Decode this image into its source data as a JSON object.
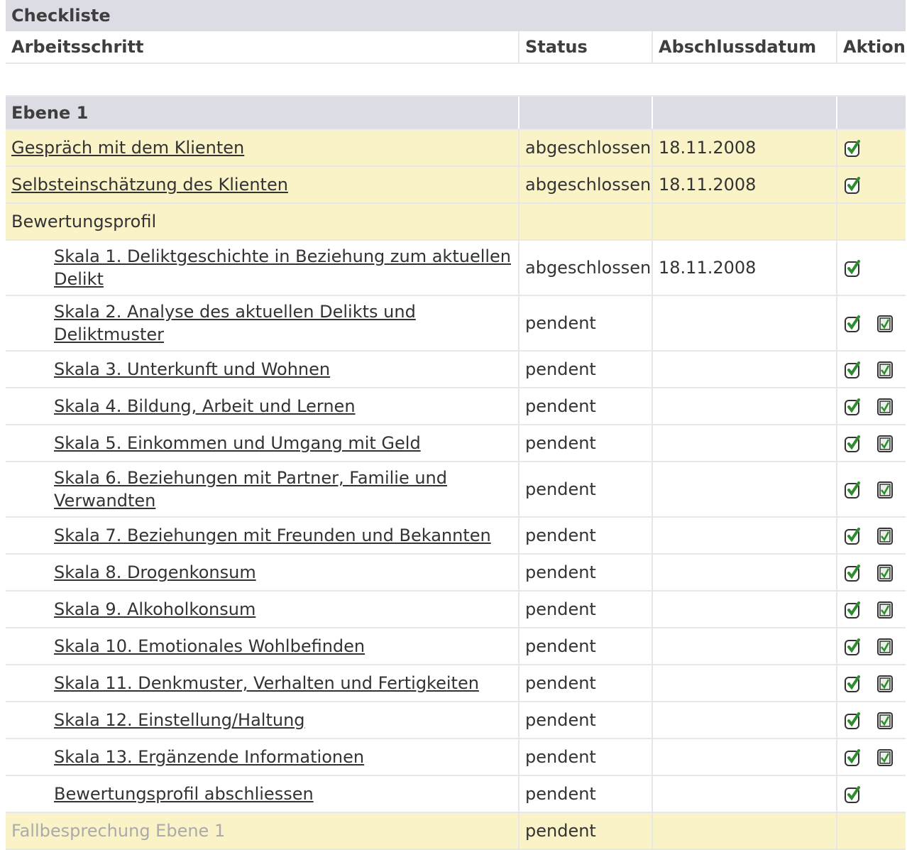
{
  "table": {
    "title": "Checkliste",
    "headers": {
      "step": "Arbeitsschritt",
      "status": "Status",
      "date": "Abschlussdatum",
      "action": "Aktion"
    },
    "level_label": "Ebene 1"
  },
  "rows": [
    {
      "label": "Gespräch mit dem Klienten",
      "status": "abgeschlossen",
      "date": "18.11.2008"
    },
    {
      "label": "Selbsteinschätzung des Klienten",
      "status": "abgeschlossen",
      "date": "18.11.2008"
    },
    {
      "label": "Bewertungsprofil",
      "status": "",
      "date": ""
    },
    {
      "label": "Skala 1. Deliktgeschichte in Beziehung zum aktuellen Delikt",
      "status": "abgeschlossen",
      "date": "18.11.2008"
    },
    {
      "label": "Skala 2. Analyse des aktuellen Delikts und Deliktmuster",
      "status": "pendent",
      "date": ""
    },
    {
      "label": "Skala 3. Unterkunft und Wohnen",
      "status": "pendent",
      "date": ""
    },
    {
      "label": "Skala 4. Bildung, Arbeit und Lernen",
      "status": "pendent",
      "date": ""
    },
    {
      "label": "Skala 5. Einkommen und Umgang mit Geld",
      "status": "pendent",
      "date": ""
    },
    {
      "label": "Skala 6. Beziehungen mit Partner, Familie und Verwandten",
      "status": "pendent",
      "date": ""
    },
    {
      "label": "Skala 7. Beziehungen mit Freunden und Bekannten",
      "status": "pendent",
      "date": ""
    },
    {
      "label": "Skala 8. Drogenkonsum",
      "status": "pendent",
      "date": ""
    },
    {
      "label": "Skala 9. Alkoholkonsum",
      "status": "pendent",
      "date": ""
    },
    {
      "label": "Skala 10. Emotionales Wohlbefinden",
      "status": "pendent",
      "date": ""
    },
    {
      "label": "Skala 11. Denkmuster, Verhalten und Fertigkeiten",
      "status": "pendent",
      "date": ""
    },
    {
      "label": "Skala 12. Einstellung/Haltung",
      "status": "pendent",
      "date": ""
    },
    {
      "label": "Skala 13. Ergänzende Informationen",
      "status": "pendent",
      "date": ""
    },
    {
      "label": "Bewertungsprofil abschliessen",
      "status": "pendent",
      "date": ""
    },
    {
      "label": "Fallbesprechung Ebene 1",
      "status": "pendent",
      "date": ""
    }
  ],
  "icons": {
    "edit": "edit-icon",
    "complete": "checkbox-icon"
  },
  "colors": {
    "group_header_bg": "#dcdce4",
    "highlight_row_bg": "#fbf3c8",
    "icon_green": "#2e8b2e"
  }
}
